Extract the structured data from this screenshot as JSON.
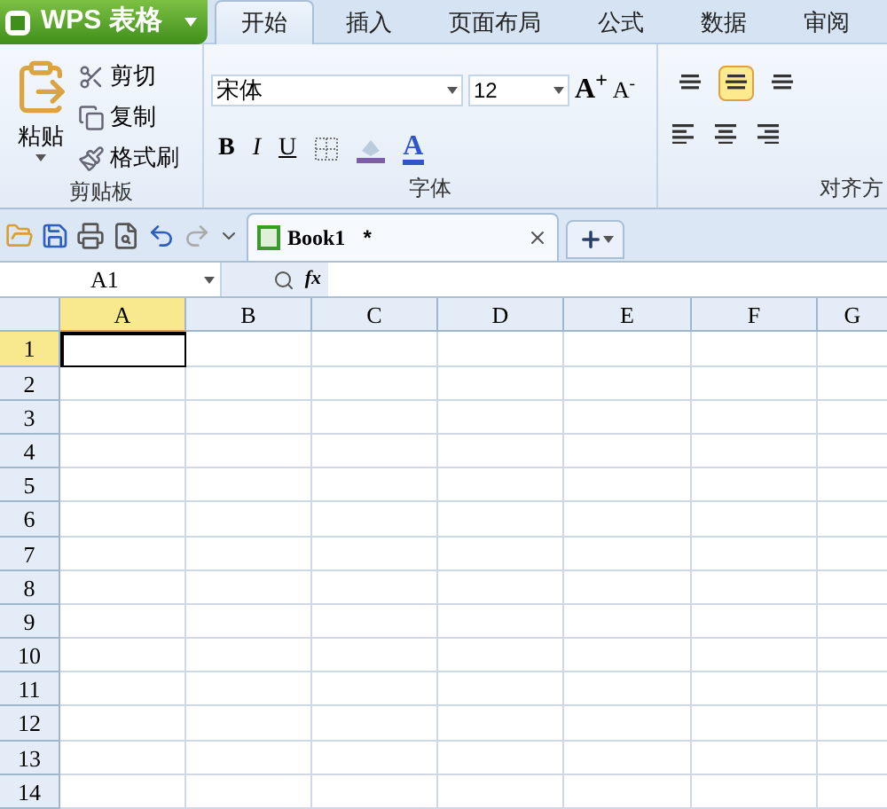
{
  "app_button": {
    "label": "WPS 表格"
  },
  "tabs": [
    {
      "label": "开始",
      "selected": true
    },
    {
      "label": "插入",
      "selected": false
    },
    {
      "label": "页面布局",
      "selected": false
    },
    {
      "label": "公式",
      "selected": false
    },
    {
      "label": "数据",
      "selected": false
    },
    {
      "label": "审阅",
      "selected": false
    }
  ],
  "clipboard": {
    "label": "剪贴板",
    "paste": "粘贴",
    "items": [
      "剪切",
      "复制",
      "格式刷"
    ]
  },
  "font": {
    "label": "字体",
    "font_name": "宋体",
    "font_size": "12",
    "bold": "B",
    "italic": "I",
    "underline": "U",
    "grow_font": "A$^{+}$",
    "shrink_font": "A$^{-}$",
    "font_color": "A"
  },
  "alignment": {
    "label": "对齐方",
    "buttons": [
      {
        "selected": false
      },
      {
        "selected": true
      },
      {
        "selected": false
      }
    ]
  },
  "doc_tab": {
    "title": "Book1",
    "modified_mark": "*"
  },
  "name_box": {
    "value": "A1"
  },
  "function_button": {
    "label": "fx"
  },
  "sheet": {
    "columns": [
      {
        "label": "A",
        "selected": true
      },
      {
        "label": "B",
        "selected": false
      },
      {
        "label": "C",
        "selected": false
      },
      {
        "label": "D",
        "selected": false
      },
      {
        "label": "E",
        "selected": false
      },
      {
        "label": "F",
        "selected": false
      },
      {
        "label": "G",
        "selected": false
      }
    ],
    "rows": [
      {
        "label": "1",
        "selected": true
      },
      {
        "label": "2",
        "selected": false
      },
      {
        "label": "3",
        "selected": false
      },
      {
        "label": "4",
        "selected": false
      },
      {
        "label": "5",
        "selected": false
      },
      {
        "label": "6",
        "selected": false
      },
      {
        "label": "7",
        "selected": false
      },
      {
        "label": "8",
        "selected": false
      },
      {
        "label": "9",
        "selected": false
      },
      {
        "label": "10",
        "selected": false
      },
      {
        "label": "11",
        "selected": false
      },
      {
        "label": "12",
        "selected": false
      },
      {
        "label": "13",
        "selected": false
      },
      {
        "label": "14",
        "selected": false
      }
    ]
  }
}
